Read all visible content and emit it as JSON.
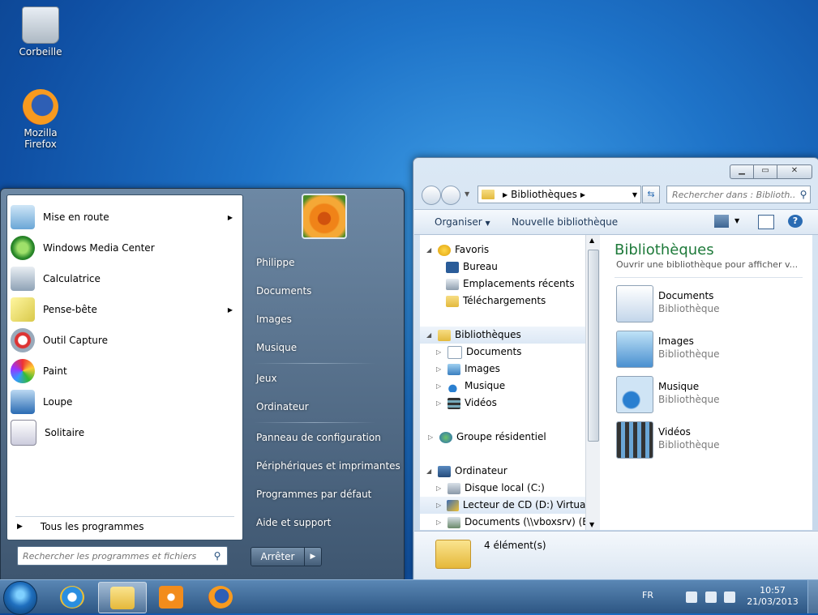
{
  "desktop": {
    "icons": [
      {
        "label": "Corbeille",
        "icon": "recycle-bin-icon"
      },
      {
        "label": "Mozilla Firefox",
        "icon": "firefox-icon"
      }
    ]
  },
  "start_menu": {
    "programs": [
      {
        "label": "Mise en route",
        "icon": "getting-started-icon",
        "has_submenu": true
      },
      {
        "label": "Windows Media Center",
        "icon": "media-center-icon",
        "has_submenu": false
      },
      {
        "label": "Calculatrice",
        "icon": "calculator-icon",
        "has_submenu": false
      },
      {
        "label": "Pense-bête",
        "icon": "sticky-notes-icon",
        "has_submenu": true
      },
      {
        "label": "Outil Capture",
        "icon": "snipping-tool-icon",
        "has_submenu": false
      },
      {
        "label": "Paint",
        "icon": "paint-icon",
        "has_submenu": false
      },
      {
        "label": "Loupe",
        "icon": "magnifier-icon",
        "has_submenu": false
      },
      {
        "label": "Solitaire",
        "icon": "solitaire-icon",
        "has_submenu": false
      }
    ],
    "all_programs": "Tous les programmes",
    "search_placeholder": "Rechercher les programmes et fichiers",
    "right_items": [
      "Philippe",
      "Documents",
      "Images",
      "Musique",
      "Jeux",
      "Ordinateur",
      "Panneau de configuration",
      "Périphériques et imprimantes",
      "Programmes par défaut",
      "Aide et support"
    ],
    "shutdown_label": "Arrêter"
  },
  "explorer": {
    "address": "Bibliothèques",
    "search_placeholder": "Rechercher dans : Biblioth...",
    "commands": {
      "organize": "Organiser",
      "new_library": "Nouvelle bibliothèque"
    },
    "nav": {
      "favorites": {
        "label": "Favoris",
        "items": [
          "Bureau",
          "Emplacements récents",
          "Téléchargements"
        ]
      },
      "libraries": {
        "label": "Bibliothèques",
        "items": [
          "Documents",
          "Images",
          "Musique",
          "Vidéos"
        ]
      },
      "homegroup": "Groupe résidentiel",
      "computer": {
        "label": "Ordinateur",
        "items": [
          "Disque local (C:)",
          "Lecteur de CD (D:) VirtualBox",
          "Documents (\\\\vboxsrv) (E:)"
        ]
      }
    },
    "content": {
      "title": "Bibliothèques",
      "subtitle": "Ouvrir une bibliothèque pour afficher v...",
      "libraries": [
        {
          "name": "Documents",
          "type": "Bibliothèque"
        },
        {
          "name": "Images",
          "type": "Bibliothèque"
        },
        {
          "name": "Musique",
          "type": "Bibliothèque"
        },
        {
          "name": "Vidéos",
          "type": "Bibliothèque"
        }
      ]
    },
    "status": "4 élément(s)"
  },
  "taskbar": {
    "language": "FR",
    "time": "10:57",
    "date": "21/03/2013"
  }
}
